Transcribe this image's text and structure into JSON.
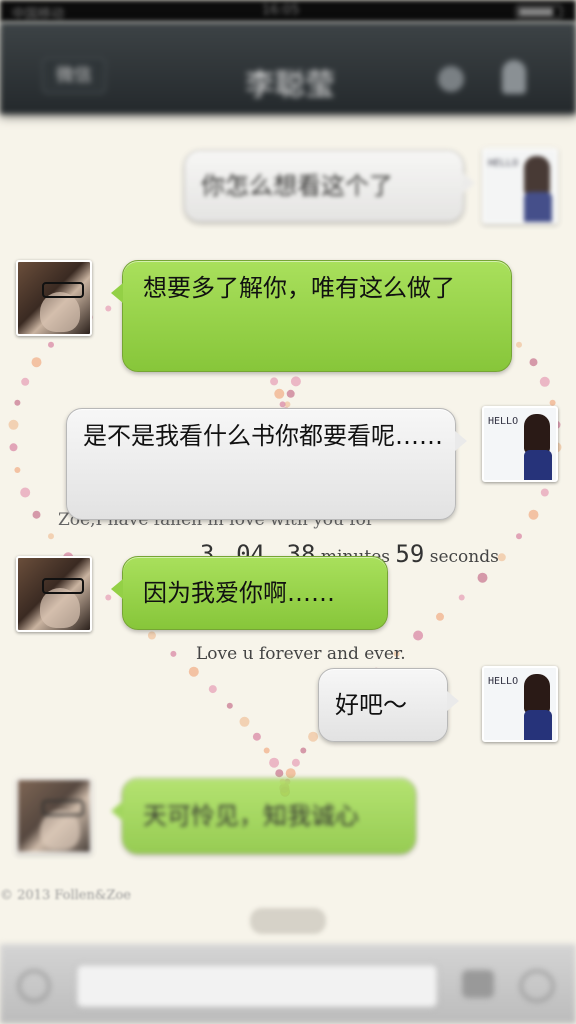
{
  "status_bar": {
    "carrier": "中国移动",
    "time": "16:05"
  },
  "nav": {
    "back_label": "微信",
    "title": "李聪莹"
  },
  "messages": [
    {
      "side": "right",
      "text": "你怎么想看这个了"
    },
    {
      "side": "left",
      "text": "想要多了解你，唯有这么做了"
    },
    {
      "side": "right",
      "text": "是不是我看什么书你都要看呢……"
    },
    {
      "side": "left",
      "text": "因为我爱你啊……"
    },
    {
      "side": "right",
      "text": "好吧～"
    },
    {
      "side": "left",
      "text": "天可怜见，知我诚心"
    }
  ],
  "watermark": {
    "line1": "Zoe,I have fallen in love with you for",
    "counter_prefix": "3",
    "counter_mid": "04",
    "counter_min": "38",
    "minutes_label": "minutes",
    "counter_sec": "59",
    "seconds_label": "seconds",
    "line3": "Love u forever and ever.",
    "copyright": "© 2013 Follen&Zoe"
  },
  "avatar_text": {
    "hello": "HELLO :)"
  },
  "colors": {
    "green_bubble": "#9bd64e",
    "gray_bubble": "#eeeeee",
    "nav_bg": "#2c3235",
    "background": "#f7f4ea"
  },
  "icons": [
    "voice-icon",
    "emoji-icon",
    "plus-icon",
    "contact-icon",
    "profile-icon"
  ]
}
